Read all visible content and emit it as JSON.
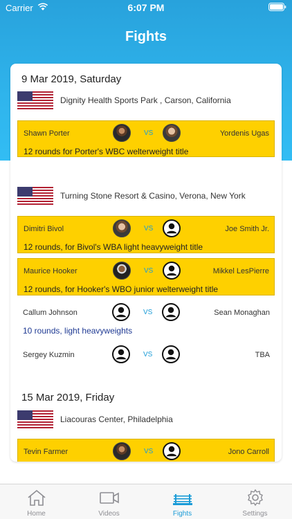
{
  "status_bar": {
    "carrier": "Carrier",
    "time": "6:07 PM"
  },
  "nav": {
    "title": "Fights"
  },
  "events": [
    {
      "date": "9 Mar 2019, Saturday",
      "venues": [
        {
          "flag": "us-flag-icon",
          "name": "Dignity Health Sports Park , Carson, California",
          "fights": [
            {
              "left": "Shawn Porter",
              "vs": "VS",
              "right": "Yordenis Ugas",
              "description": "12 rounds for Porter's WBC welterweight title",
              "featured": true
            }
          ]
        },
        {
          "flag": "us-flag-icon",
          "name": "Turning Stone Resort & Casino, Verona, New York",
          "fights": [
            {
              "left": "Dimitri Bivol",
              "vs": "VS",
              "right": "Joe Smith Jr.",
              "description": "12 rounds, for Bivol's WBA light heavyweight title",
              "featured": true
            },
            {
              "left": "Maurice Hooker",
              "vs": "VS",
              "right": "Mikkel LesPierre",
              "description": "12 rounds, for Hooker's WBO junior welterweight title",
              "featured": true
            },
            {
              "left": "Callum Johnson",
              "vs": "VS",
              "right": "Sean Monaghan",
              "description": "10 rounds, light heavyweights",
              "featured": false
            },
            {
              "left": "Sergey Kuzmin",
              "vs": "VS",
              "right": "TBA",
              "description": "",
              "featured": false
            }
          ]
        }
      ]
    },
    {
      "date": "15 Mar 2019, Friday",
      "venues": [
        {
          "flag": "us-flag-icon",
          "name": "Liacouras Center, Philadelphia",
          "fights": [
            {
              "left": "Tevin Farmer",
              "vs": "VS",
              "right": "Jono Carroll",
              "description": "",
              "featured": true
            }
          ]
        }
      ]
    }
  ],
  "tabbar": {
    "items": [
      {
        "label": "Home",
        "icon": "home-icon"
      },
      {
        "label": "Videos",
        "icon": "video-icon"
      },
      {
        "label": "Fights",
        "icon": "boxing-ring-icon",
        "active": true
      },
      {
        "label": "Settings",
        "icon": "gear-icon"
      }
    ]
  },
  "colors": {
    "header": "#2fb4ec",
    "featured_fight": "#fed000",
    "accent": "#1a9bd7",
    "plain_description": "#1f3a93"
  }
}
